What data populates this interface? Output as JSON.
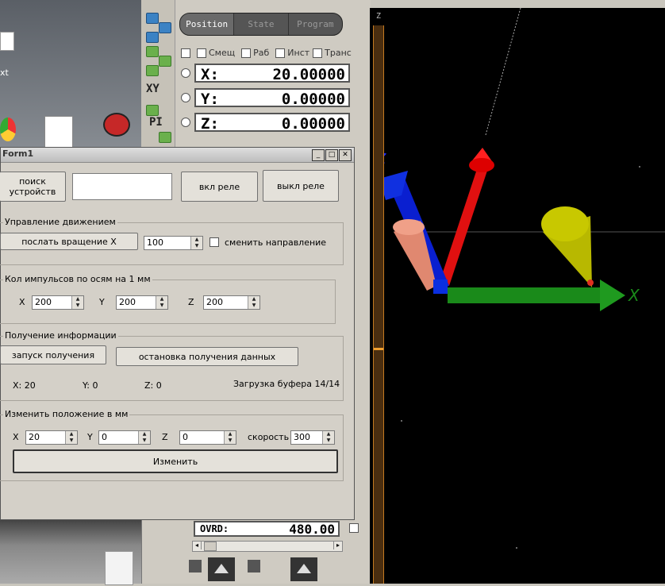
{
  "desktop": {
    "file_label": "xt"
  },
  "cnc": {
    "tabs": [
      "Position",
      "State",
      "Program"
    ],
    "checkboxes": [
      "Смещ",
      "Раб",
      "Инст",
      "Транс"
    ],
    "coords": [
      {
        "axis": "X:",
        "value": "20.00000"
      },
      {
        "axis": "Y:",
        "value": "0.00000"
      },
      {
        "axis": "Z:",
        "value": "0.00000"
      }
    ],
    "jog_labels": [
      "XY",
      "PI"
    ],
    "ovrd": {
      "label": "OVRD:",
      "value": "480.00"
    }
  },
  "view3d": {
    "axis_z": "Z",
    "axis_z_top": "Z",
    "axis_x": "X"
  },
  "form1": {
    "title": "Form1",
    "search_button": "поиск устройств",
    "device_field": "",
    "relay_on": "вкл реле",
    "relay_off": "выкл реле",
    "motion": {
      "title": "Управление движением",
      "send_rotation": "послать вращение X",
      "rotation_value": "100",
      "reverse_label": "сменить направление"
    },
    "pulses": {
      "title": "Кол импульсов по осям на 1 мм",
      "x_label": "X",
      "x_value": "200",
      "y_label": "Y",
      "y_value": "200",
      "z_label": "Z",
      "z_value": "200"
    },
    "info": {
      "title": "Получение информации",
      "start": "запуск получения",
      "stop": "остановка получения данных",
      "x": "X: 20",
      "y": "Y: 0",
      "z": "Z: 0",
      "buffer": "Загрузка буфера 14/14"
    },
    "position": {
      "title": "Изменить положение в мм",
      "x_label": "X",
      "x_value": "20",
      "y_label": "Y",
      "y_value": "0",
      "z_label": "Z",
      "z_value": "0",
      "speed_label": "скорость",
      "speed_value": "300",
      "apply": "Изменить"
    }
  }
}
